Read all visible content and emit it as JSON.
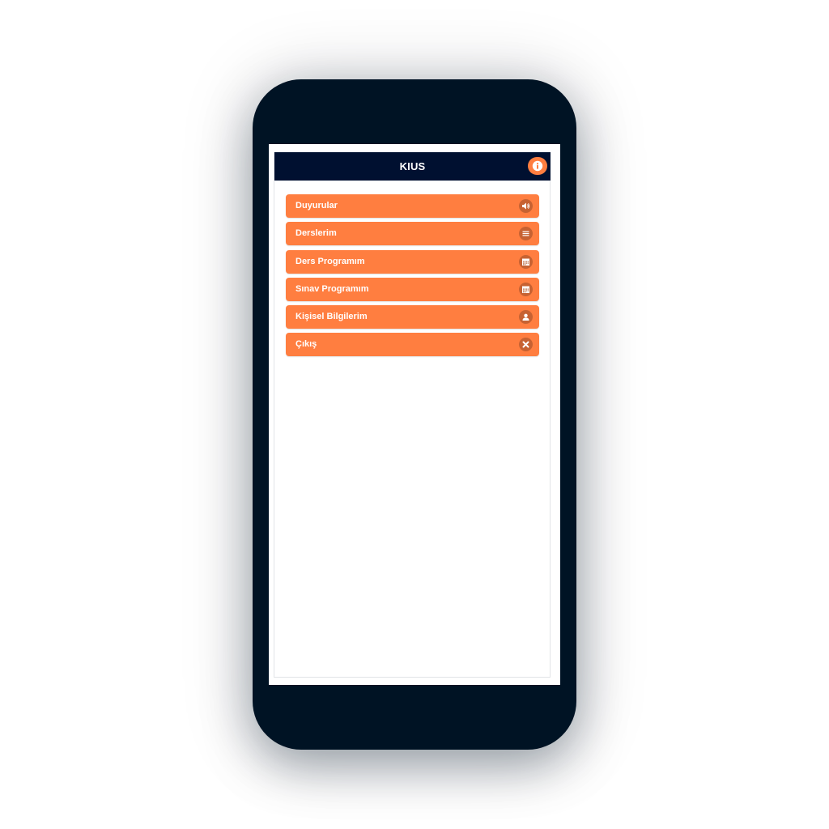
{
  "header": {
    "title": "KIUS",
    "info_icon": "info-icon"
  },
  "menu": {
    "items": [
      {
        "label": "Duyurular",
        "icon": "speaker-icon"
      },
      {
        "label": "Derslerim",
        "icon": "list-icon"
      },
      {
        "label": "Ders Programım",
        "icon": "calendar-icon"
      },
      {
        "label": "Sınav Programım",
        "icon": "calendar-icon"
      },
      {
        "label": "Kişisel Bilgilerim",
        "icon": "user-icon"
      },
      {
        "label": "Çıkış",
        "icon": "close-icon"
      }
    ]
  },
  "colors": {
    "phone_frame": "#001324",
    "header_bg": "#001030",
    "accent": "#ff7e40",
    "text_on_accent": "#ffffff"
  }
}
